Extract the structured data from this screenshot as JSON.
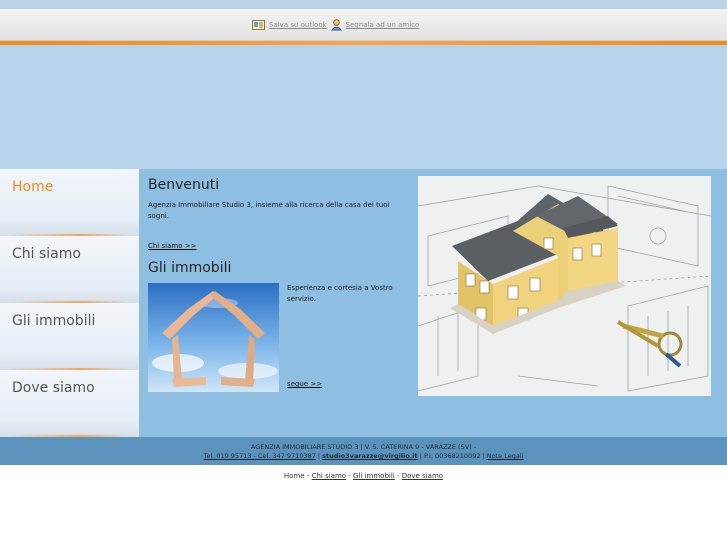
{
  "toolbar": {
    "save_outlook": "Salva su outlook",
    "recommend": "Segnala ad un amico"
  },
  "nav": {
    "home": "Home",
    "chi_siamo": "Chi siamo",
    "gli_immobili": "Gli immobili",
    "dove_siamo": "Dove siamo"
  },
  "content": {
    "welcome_title": "Benvenuti",
    "welcome_text": "Agenzia Immobiliare Studio 3, insieme alla ricerca della casa dei tuoi sogni.",
    "chi_siamo_link": "Chi siamo >>",
    "immobili_title": "Gli immobili",
    "immobili_text": "Esperienza e cortesia a Vostro servizio.",
    "segue_link": "segue >>"
  },
  "footer": {
    "line1": "AGENZIA IMMOBILIARE STUDIO 3 | V. S. CATERINA 9 - VARAZZE (SV) -",
    "phones": "Tel. 019 95713 - Cel. 347 9710387",
    "sep1": " | ",
    "email": "studio3varazze@virgilio.it",
    "piva": " | P.I. 00368210092 | ",
    "legal": "Note Legali"
  },
  "bottom_nav": {
    "home": "Home",
    "sep": " - ",
    "chi_siamo": "Chi siamo",
    "gli_immobili": "Gli immobili",
    "dove_siamo": "Dove siamo"
  },
  "colors": {
    "accent": "#f08a1a",
    "content_bg": "#8ebfe3",
    "footer_bg": "#5b93bd"
  }
}
